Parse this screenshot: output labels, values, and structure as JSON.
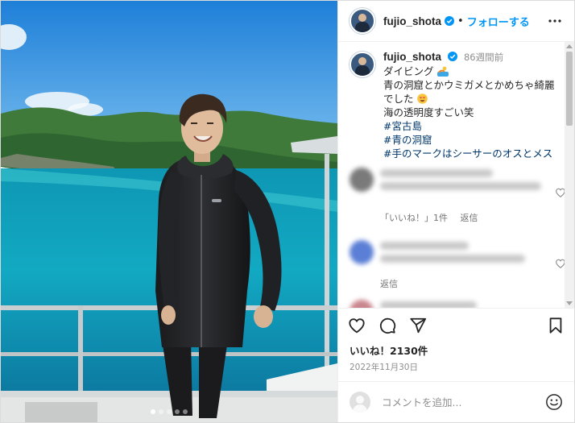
{
  "post": {
    "username": "fujio_shota",
    "follow_label": "フォローする",
    "separator": "•",
    "caption": {
      "username": "fujio_shota",
      "time": "86週間前",
      "lines": [
        "ダイビング",
        "青の洞窟とかウミガメとかめちゃ綺麗",
        "でした",
        "海の透明度すごい笑"
      ],
      "hashtags": [
        "#宮古島",
        "#青の洞窟",
        "#手のマークはシーサーのオスとメス"
      ]
    },
    "comments": [
      {
        "like_count_label": "「いいね！」1件",
        "reply_label": "返信"
      },
      {
        "reply_label": "返信"
      }
    ],
    "likes_label": "いいね！2130件",
    "date": "2022年11月30日",
    "comment_placeholder": "コメントを追加...",
    "carousel": {
      "count": 5,
      "active_index": 0
    }
  },
  "icons": {
    "more": "more-horizontal-icon",
    "verified": "verified-badge-icon",
    "like": "heart-icon",
    "comment": "comment-icon",
    "share": "paper-plane-icon",
    "save": "bookmark-icon",
    "emoji": "smiley-icon"
  },
  "colors": {
    "follow_link": "#0095f6",
    "hashtag": "#00376b",
    "muted_text": "#8e8e8e"
  }
}
